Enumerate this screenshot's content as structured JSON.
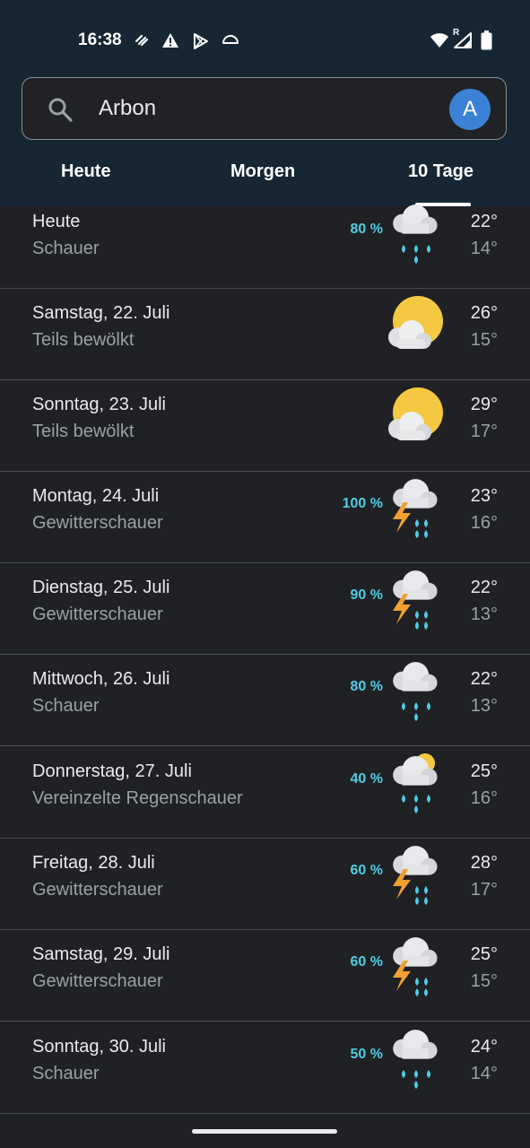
{
  "status": {
    "time": "16:38",
    "roaming": "R"
  },
  "search": {
    "query": "Arbon",
    "avatar_letter": "A"
  },
  "tabs": [
    {
      "label": "Heute"
    },
    {
      "label": "Morgen"
    },
    {
      "label": "10 Tage",
      "selected": true
    }
  ],
  "forecast": [
    {
      "day": "Heute",
      "condition": "Schauer",
      "precip": "80 %",
      "high": "22°",
      "low": "14°",
      "icon": "rain-icon"
    },
    {
      "day": "Samstag, 22. Juli",
      "condition": "Teils bewölkt",
      "precip": "",
      "high": "26°",
      "low": "15°",
      "icon": "partly-cloudy-icon"
    },
    {
      "day": "Sonntag, 23. Juli",
      "condition": "Teils bewölkt",
      "precip": "",
      "high": "29°",
      "low": "17°",
      "icon": "partly-cloudy-icon"
    },
    {
      "day": "Montag, 24. Juli",
      "condition": "Gewitterschauer",
      "precip": "100 %",
      "high": "23°",
      "low": "16°",
      "icon": "thunderstorm-icon"
    },
    {
      "day": "Dienstag, 25. Juli",
      "condition": "Gewitterschauer",
      "precip": "90 %",
      "high": "22°",
      "low": "13°",
      "icon": "thunderstorm-icon"
    },
    {
      "day": "Mittwoch, 26. Juli",
      "condition": "Schauer",
      "precip": "80 %",
      "high": "22°",
      "low": "13°",
      "icon": "rain-icon"
    },
    {
      "day": "Donnerstag, 27. Juli",
      "condition": "Vereinzelte Regenschauer",
      "precip": "40 %",
      "high": "25°",
      "low": "16°",
      "icon": "scattered-showers-icon"
    },
    {
      "day": "Freitag, 28. Juli",
      "condition": "Gewitterschauer",
      "precip": "60 %",
      "high": "28°",
      "low": "17°",
      "icon": "thunderstorm-icon"
    },
    {
      "day": "Samstag, 29. Juli",
      "condition": "Gewitterschauer",
      "precip": "60 %",
      "high": "25°",
      "low": "15°",
      "icon": "thunderstorm-icon"
    },
    {
      "day": "Sonntag, 30. Juli",
      "condition": "Schauer",
      "precip": "50 %",
      "high": "24°",
      "low": "14°",
      "icon": "rain-icon"
    }
  ],
  "colors": {
    "header_bg": "#162733",
    "body_bg": "#202124",
    "precip": "#4ecde6",
    "sun": "#f5c842",
    "bolt": "#f0a030",
    "avatar": "#3b82d6"
  }
}
